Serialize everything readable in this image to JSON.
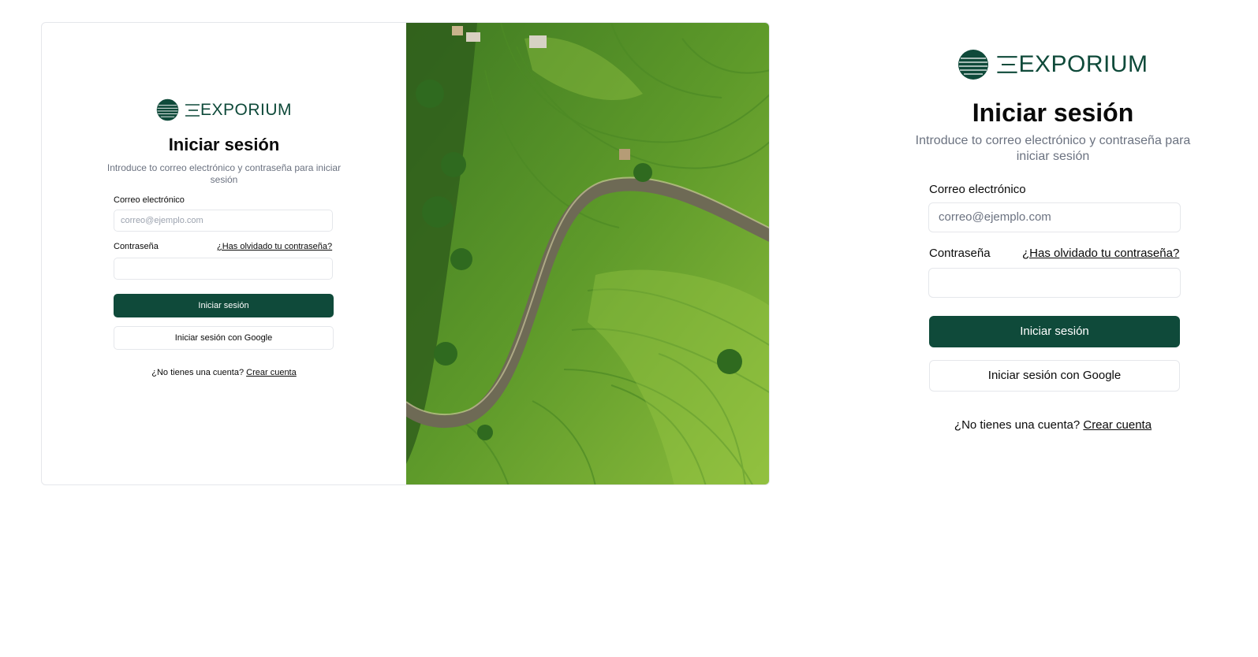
{
  "brand": {
    "name": "EXPORIUM",
    "color": "#0f4a3a",
    "logo_icon": "striped-globe-icon"
  },
  "login": {
    "title": "Iniciar sesión",
    "subtitle": "Introduce to correo electrónico y contraseña para iniciar sesión",
    "email_label": "Correo electrónico",
    "email_placeholder": "correo@ejemplo.com",
    "password_label": "Contraseña",
    "forgot_link": "¿Has olvidado tu contraseña?",
    "submit_label": "Iniciar sesión",
    "google_label": "Iniciar sesión con Google",
    "no_account_text": "¿No tienes una cuenta?",
    "create_account_link": "Crear cuenta"
  },
  "hero_image": {
    "subject": "aerial view of green rice terraces with a winding dirt path",
    "icon": "terrace-photo"
  },
  "colors": {
    "primary": "#0f4a3a",
    "muted_text": "#6b7280",
    "border": "#e5e7eb"
  }
}
